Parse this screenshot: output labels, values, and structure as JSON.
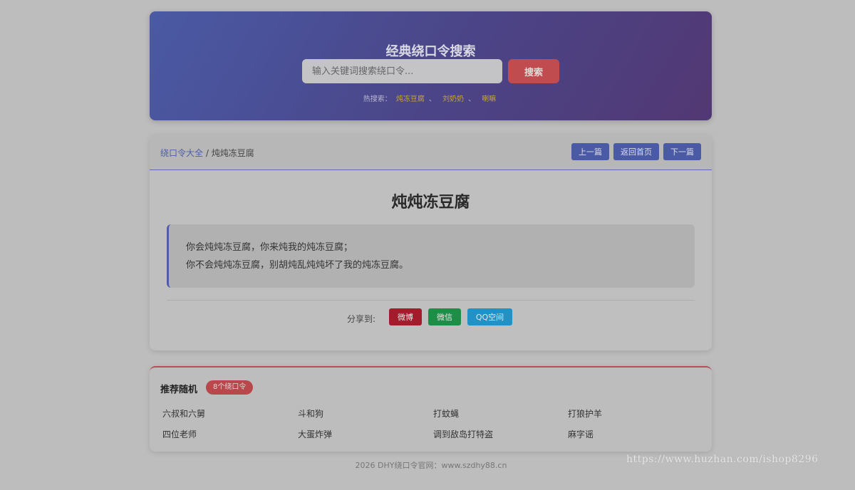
{
  "hero": {
    "title": "经典绕口令搜索",
    "search_placeholder": "输入关键词搜索绕口令...",
    "search_button": "搜索",
    "hot_label": "热搜索：",
    "hot_links": [
      "炖冻豆腐",
      "刘奶奶",
      "喇嘛"
    ],
    "hot_sep": "、"
  },
  "breadcrumb": {
    "home": "绕口令大全",
    "sep": "/",
    "current": "炖炖冻豆腐"
  },
  "nav": {
    "prev": "上一篇",
    "home": "返回首页",
    "next": "下一篇"
  },
  "article": {
    "title": "炖炖冻豆腐",
    "lines": [
      "你会炖炖冻豆腐，你来炖我的炖冻豆腐；",
      "你不会炖炖冻豆腐，别胡炖乱炖炖坏了我的炖冻豆腐。"
    ]
  },
  "share": {
    "label": "分享到:",
    "weibo": "微博",
    "wechat": "微信",
    "qzone": "QQ空间"
  },
  "recommend": {
    "title": "推荐随机",
    "badge": "8个绕口令",
    "items": [
      "六叔和六舅",
      "斗和狗",
      "打蚊蝇",
      "打狼护羊",
      "四位老师",
      "大蛋炸弹",
      "调到敌岛打特盗",
      "麻字谣"
    ]
  },
  "footer": "2026 DHY绕口令官网：www.szdhy88.cn",
  "watermark": "https://www.huzhan.com/ishop8296",
  "colors": {
    "accent": "#4a5aa4",
    "danger": "#c14c50",
    "weibo": "#a21c2c",
    "wechat": "#1e8e47",
    "qzone": "#2192c6"
  }
}
